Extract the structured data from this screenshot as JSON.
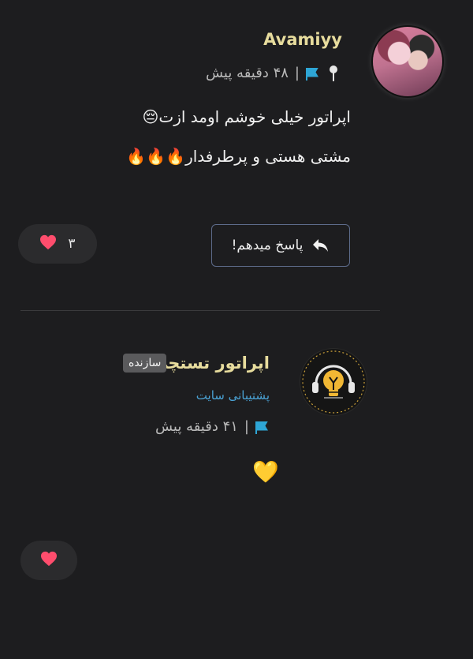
{
  "comments": [
    {
      "username": "Avamiyy",
      "time": "۴۸ دقیقه پیش",
      "separator": "|",
      "lines": [
        "اپراتور خیلی خوشم اومد ازت😔",
        "مشتی هستی و پرطرفدار🔥🔥🔥"
      ],
      "reply_label": "پاسخ میدهم!",
      "like_count": "۳",
      "like_icon": "heart-icon"
    },
    {
      "username": "اپراتور تستچی",
      "badge": "سازنده",
      "role": "پشتیبانی سایت",
      "time": "۴۱ دقیقه پیش",
      "separator": "|",
      "text": "💛",
      "like_count": "",
      "like_icon": "heart-icon"
    }
  ],
  "colors": {
    "background": "#1d1d1f",
    "username": "#e7dc9d",
    "role": "#4aa2d4",
    "flag": "#2ea6d6",
    "heart": "#ff4d6d",
    "reply_border": "#5d6b8a"
  }
}
